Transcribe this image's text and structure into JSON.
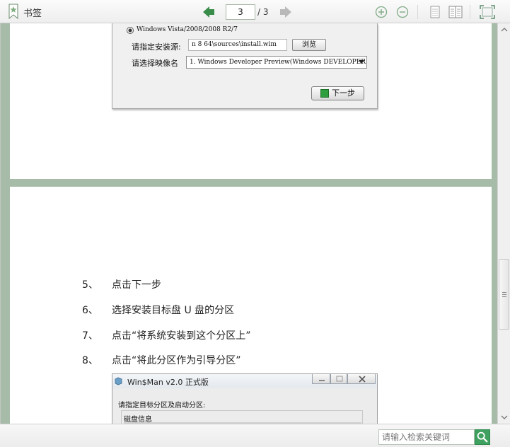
{
  "toolbar": {
    "bookmark_label": "书签",
    "current_page": "3",
    "page_total": "/ 3",
    "icons": [
      "bookmark-icon",
      "prev-page-icon",
      "next-page-icon",
      "zoom-in-icon",
      "zoom-out-icon",
      "single-page-icon",
      "double-page-icon",
      "fullscreen-icon"
    ],
    "accent_color": "#3a8c4a"
  },
  "install_dialog": {
    "radio_label": "Windows Vista/2008/2008 R2/7",
    "source_label": "请指定安装源:",
    "source_value": "n 8 64\\sources\\install.wim",
    "browse_label": "浏览",
    "image_label": "请选择映像名",
    "image_value": "1. Windows Developer Preview(Windows DEVELOPER",
    "next_label": "下一步"
  },
  "steps": [
    {
      "num": "5、",
      "text": "点击下一步"
    },
    {
      "num": "6、",
      "text": "选择安装目标盘 U 盘的分区"
    },
    {
      "num": "7、",
      "text": "点击“将系统安装到这个分区上”"
    },
    {
      "num": "8、",
      "text": "点击“将此分区作为引导分区”"
    }
  ],
  "partition_dialog": {
    "title": "Win$Man v2.0 正式版",
    "prompt": "请指定目标分区及启动分区:",
    "disk_info": "磁盘信息"
  },
  "statusbar": {
    "search_placeholder": "请输入检索关键词"
  }
}
